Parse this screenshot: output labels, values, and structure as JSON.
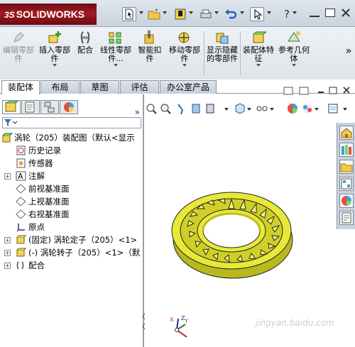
{
  "app": {
    "logo_text": "SOLIDWORKS",
    "logo_prefix": "3S",
    "brand_color": "#a51a22"
  },
  "ribbon": {
    "buttons": [
      {
        "label": "编辑零部件",
        "icon": "edit-component-icon",
        "disabled": true
      },
      {
        "label": "插入零部件",
        "icon": "insert-component-icon",
        "disabled": false
      },
      {
        "label": "配合",
        "icon": "mate-icon",
        "disabled": false
      },
      {
        "label": "线性零部件...",
        "icon": "linear-pattern-icon",
        "disabled": false
      },
      {
        "label": "智能扣件",
        "icon": "smart-fastener-icon",
        "disabled": false
      },
      {
        "label": "移动零部件",
        "icon": "move-component-icon",
        "disabled": false
      },
      {
        "label": "显示隐藏的零部件",
        "icon": "show-hidden-icon",
        "disabled": false
      },
      {
        "label": "装配体特征",
        "icon": "assembly-feature-icon",
        "disabled": false
      },
      {
        "label": "参考几何体",
        "icon": "reference-geometry-icon",
        "disabled": false
      }
    ],
    "more": "»"
  },
  "tabs": [
    "装配体",
    "布局",
    "草图",
    "评估",
    "办公室产品"
  ],
  "panel": {
    "collapse": "»",
    "tree": [
      {
        "label": "涡轮（205）装配图（默认<显示",
        "icon": "assembly-icon",
        "expand": "-"
      },
      {
        "label": "历史记录",
        "icon": "history-icon",
        "expand": ""
      },
      {
        "label": "传感器",
        "icon": "sensor-icon",
        "expand": ""
      },
      {
        "label": "注解",
        "icon": "annotation-icon",
        "expand": "+"
      },
      {
        "label": "前视基准面",
        "icon": "plane-icon",
        "expand": ""
      },
      {
        "label": "上视基准面",
        "icon": "plane-icon",
        "expand": ""
      },
      {
        "label": "右视基准面",
        "icon": "plane-icon",
        "expand": ""
      },
      {
        "label": "原点",
        "icon": "origin-icon",
        "expand": ""
      },
      {
        "label": "(固定) 涡轮定子（205）<1>",
        "icon": "part-icon",
        "expand": "+"
      },
      {
        "label": "(-) 涡轮转子（205）<1>（默",
        "icon": "part-icon",
        "expand": "+"
      },
      {
        "label": "配合",
        "icon": "mates-folder-icon",
        "expand": "+"
      }
    ]
  },
  "graphics": {
    "part_color": "#e8e83a",
    "watermark": "jingyan.baidu.com",
    "triad": {
      "x": "X",
      "y": "Y",
      "z": "Z"
    }
  }
}
